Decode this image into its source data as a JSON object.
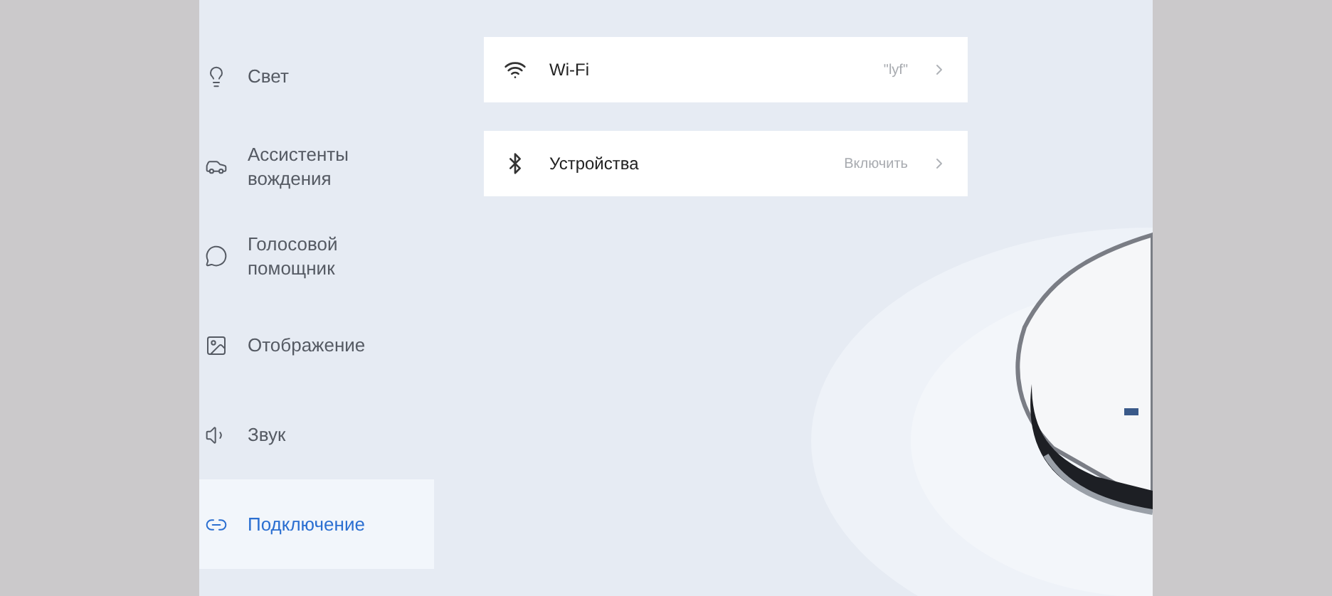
{
  "sidebar": {
    "items": [
      {
        "label": "Свет",
        "selected": false
      },
      {
        "label": "Ассистенты вождения",
        "selected": false
      },
      {
        "label": "Голосовой помощник",
        "selected": false
      },
      {
        "label": "Отображение",
        "selected": false
      },
      {
        "label": "Звук",
        "selected": false
      },
      {
        "label": "Подключение",
        "selected": true
      }
    ]
  },
  "settings": [
    {
      "label": "Wi-Fi",
      "value": "\"lyf\""
    },
    {
      "label": "Устройства",
      "value": "Включить"
    }
  ]
}
